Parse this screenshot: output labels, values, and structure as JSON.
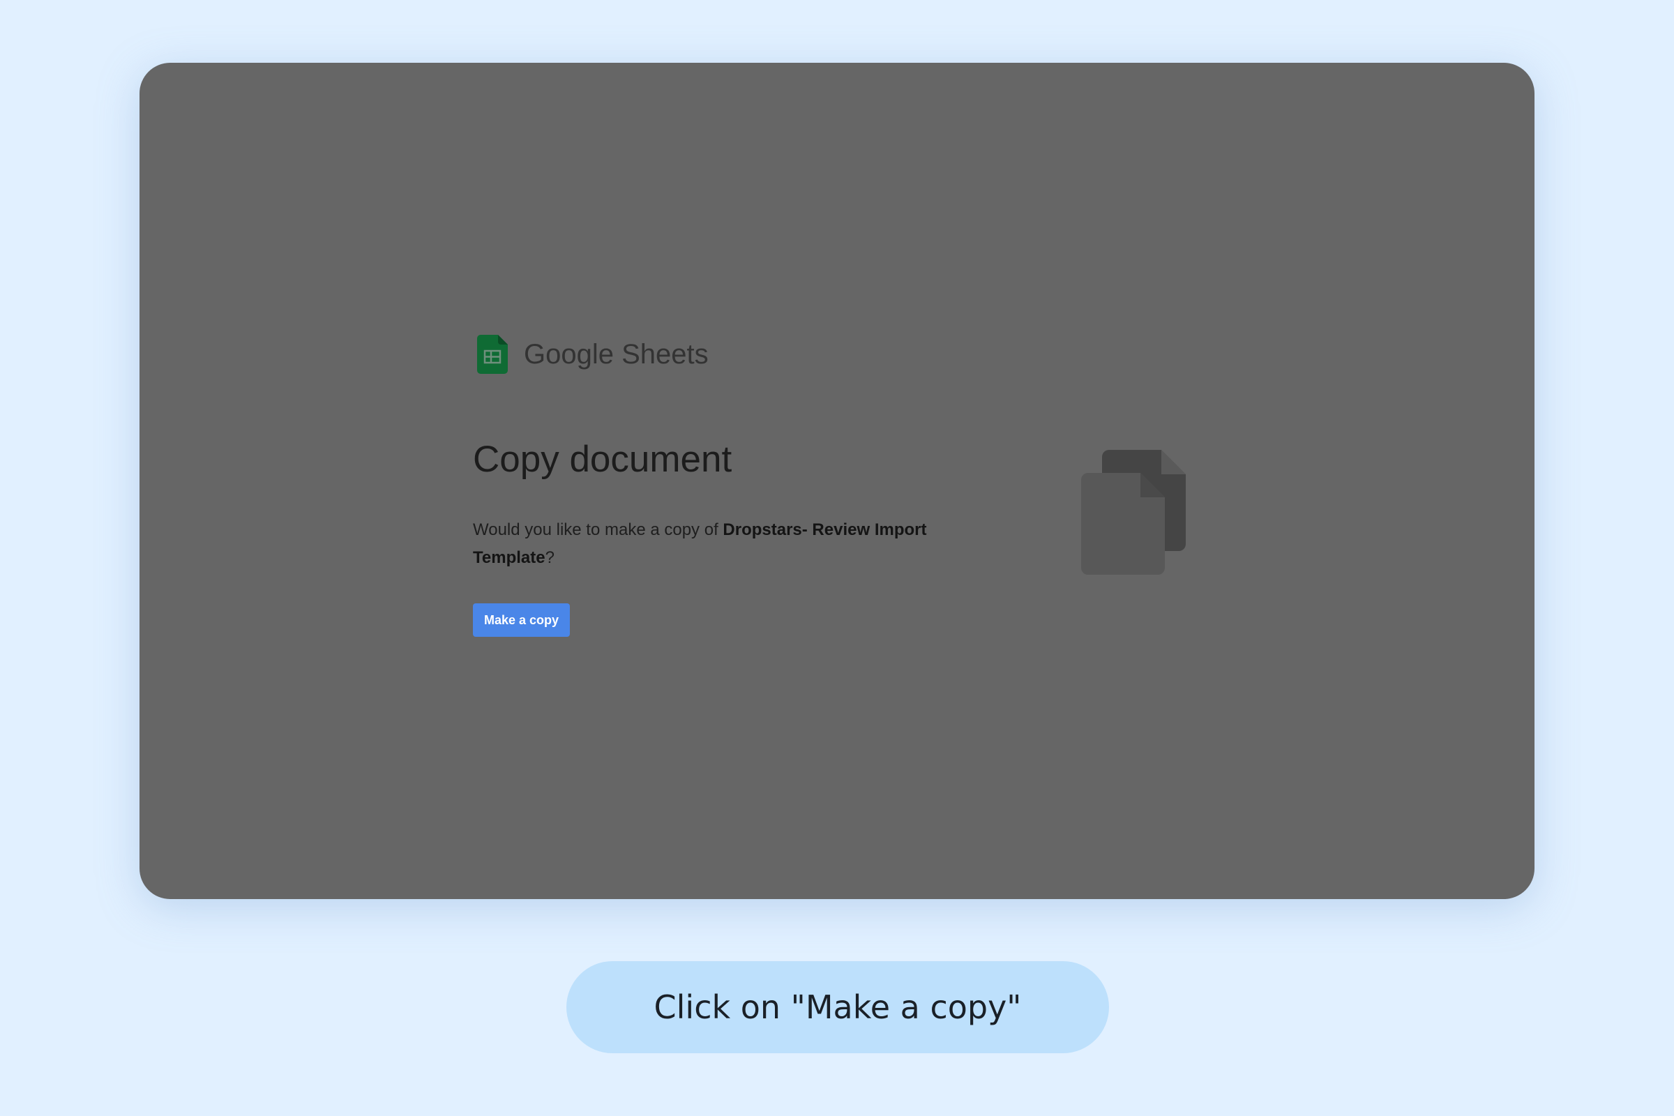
{
  "brand": {
    "name": "Google Sheets",
    "icon": "google-sheets-icon",
    "icon_color": "#0f6b34"
  },
  "dialog": {
    "title": "Copy document",
    "message_prefix": "Would you like to make a copy of ",
    "document_name": "Dropstars- Review Import Template",
    "message_suffix": "?",
    "button_label": "Make a copy",
    "button_color": "#4a86e8",
    "illustration_icon": "copy-documents-icon"
  },
  "caption": {
    "text": "Click on \"Make a copy\""
  },
  "colors": {
    "page_background": "#e1f0ff",
    "screen_overlay": "#666666",
    "caption_background": "#bde0fc"
  }
}
